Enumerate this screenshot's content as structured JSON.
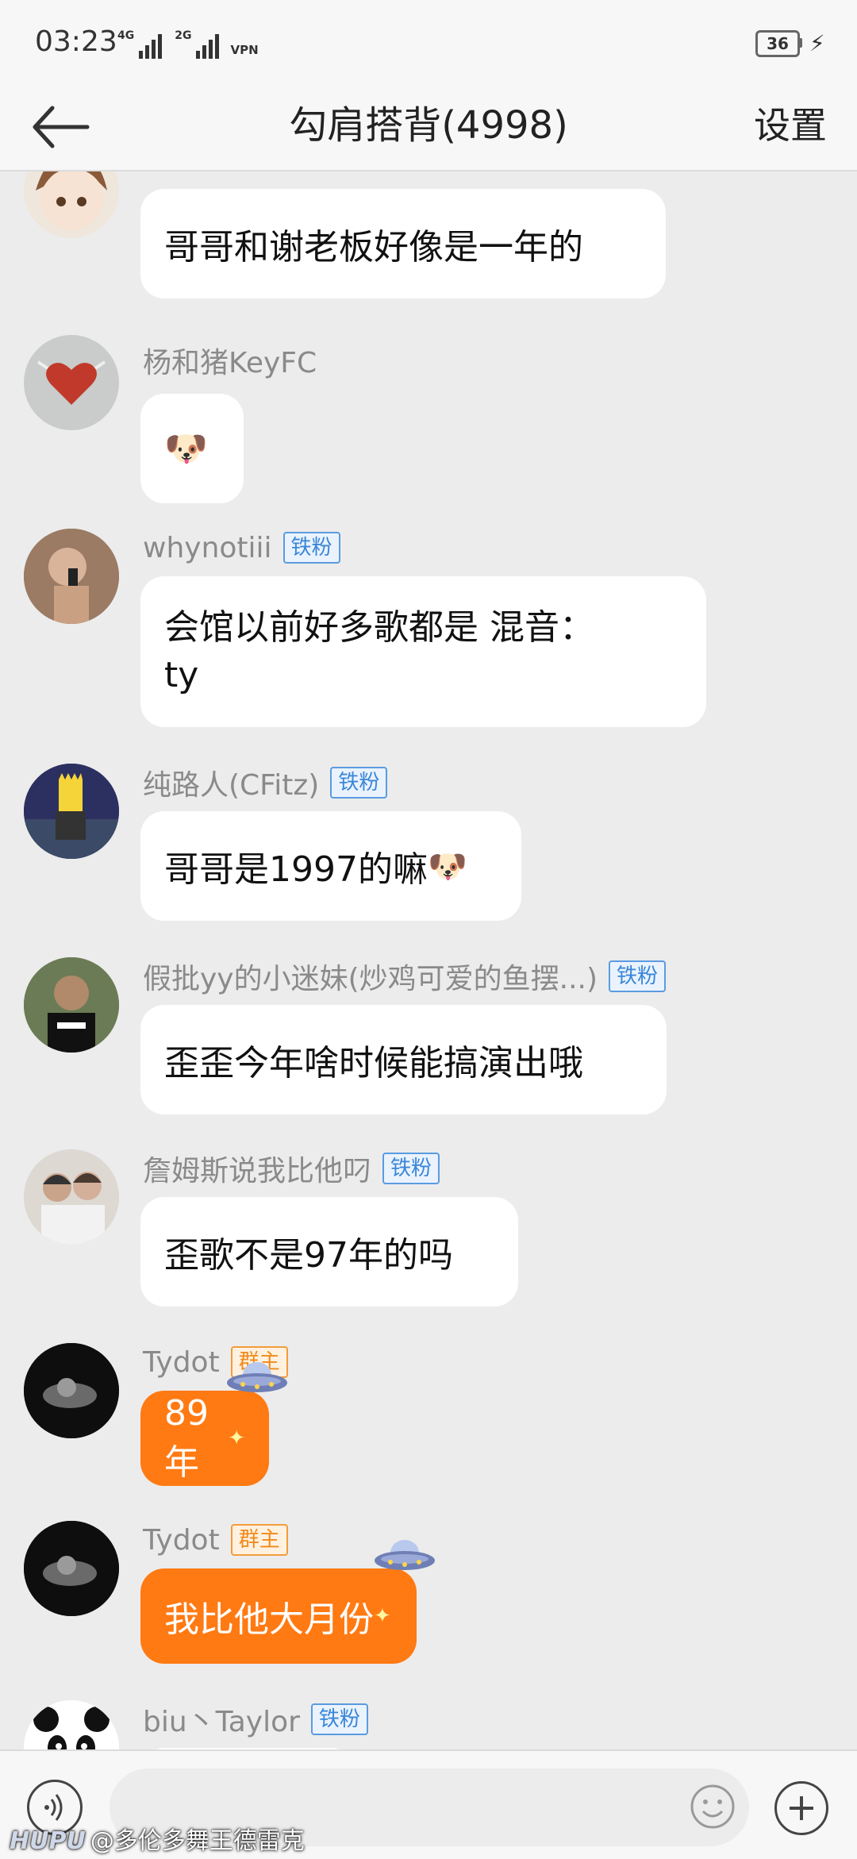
{
  "status_bar": {
    "time": "03:23",
    "net1": "4G",
    "net2": "2G",
    "vpn": "VPN",
    "battery": "36"
  },
  "header": {
    "title": "勾肩搭背(4998)",
    "settings_label": "设置"
  },
  "messages": [
    {
      "nickname": "",
      "badge": "",
      "text": "哥哥和谢老板好像是一年的",
      "avatar": "anime-avatar"
    },
    {
      "nickname": "杨和猪KeyFC",
      "badge": "",
      "text": "",
      "emoji": "doge",
      "avatar": "heart-album-avatar"
    },
    {
      "nickname": "whynotiii",
      "badge": "铁粉",
      "text_line1": "会馆以前好多歌都是  混音：",
      "text_line2": "ty",
      "avatar": "selfie-avatar"
    },
    {
      "nickname": "纯路人(CFitz)",
      "badge": "铁粉",
      "text": "哥哥是1997的嘛",
      "emoji": "doge",
      "avatar": "bart-avatar"
    },
    {
      "nickname": "假批yy的小迷妹(炒鸡可爱的鱼摆...)",
      "badge": "铁粉",
      "text": "歪歪今年啥时候能搞演出哦",
      "avatar": "man-green-avatar"
    },
    {
      "nickname": "詹姆斯说我比他叼",
      "badge": "铁粉",
      "text": "歪歌不是97年的吗",
      "avatar": "couple-avatar"
    },
    {
      "nickname": "Tydot",
      "badge": "群主",
      "text": "89年",
      "avatar": "dark-photo-avatar"
    },
    {
      "nickname": "Tydot",
      "badge": "群主",
      "text": "我比他大月份",
      "avatar": "dark-photo-avatar"
    },
    {
      "nickname": "biu丶Taylor",
      "badge": "铁粉",
      "text": "",
      "avatar": "panda-avatar"
    }
  ],
  "input": {
    "placeholder": ""
  },
  "watermark": {
    "logo": "HUPU",
    "text": "@多伦多舞王德雷克"
  },
  "colors": {
    "bubble_owner": "#ff7a13",
    "badge_fan": "#3a86d8",
    "badge_owner": "#f08a1a"
  }
}
